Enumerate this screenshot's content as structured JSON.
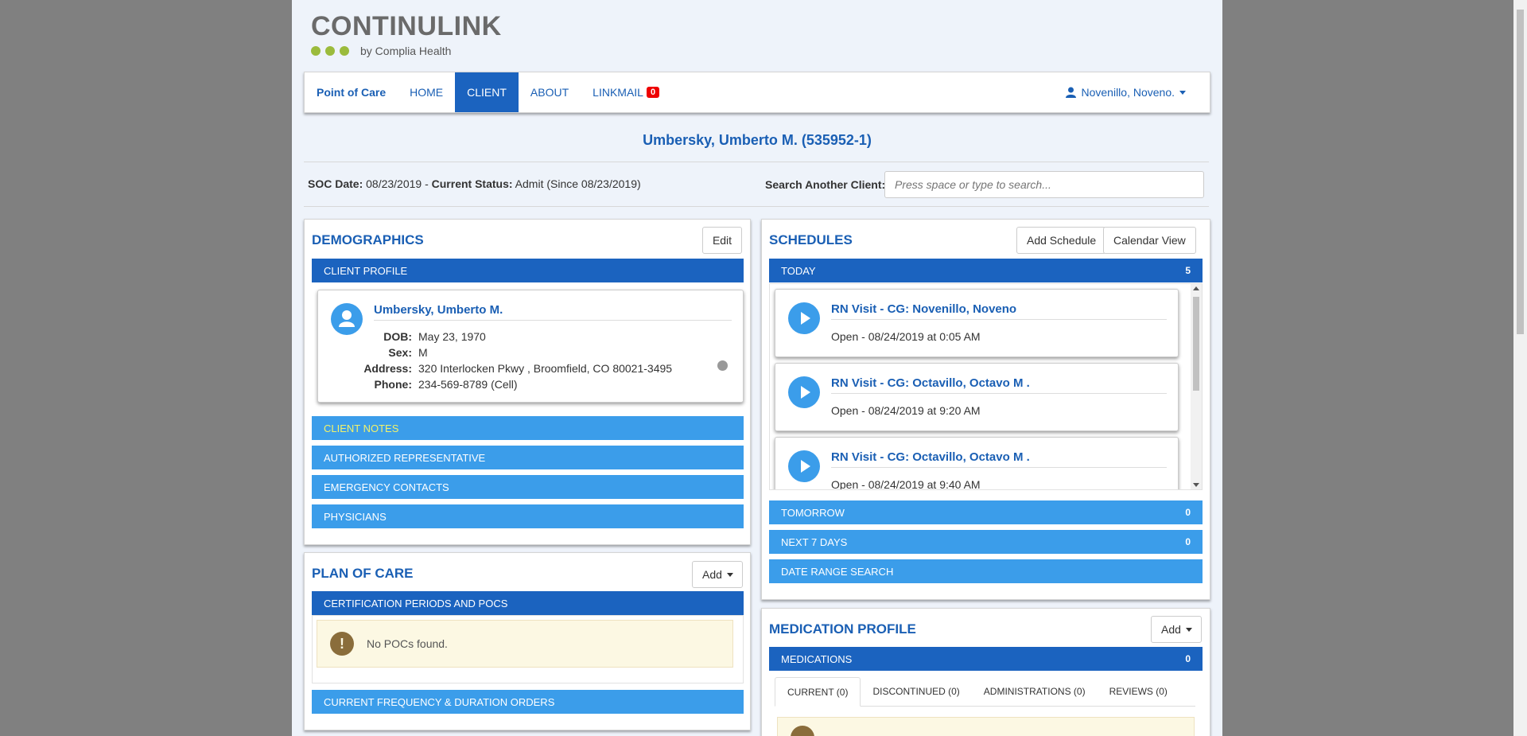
{
  "logo": {
    "word": "CONTINULINK",
    "by": "by Complia Health"
  },
  "nav": {
    "brand": "Point of Care",
    "items": [
      {
        "label": "HOME"
      },
      {
        "label": "CLIENT"
      },
      {
        "label": "ABOUT"
      },
      {
        "label": "LINKMAIL"
      }
    ],
    "linkmail_count": "0",
    "user": "Novenillo, Noveno."
  },
  "client": {
    "title": "Umbersky, Umberto M. (535952-1)",
    "soc_label": "SOC Date:",
    "soc_value": "08/23/2019 -",
    "status_label": "Current Status:",
    "status_value": "Admit (Since 08/23/2019)"
  },
  "search": {
    "label": "Search Another Client:",
    "placeholder": "Press space or type to search..."
  },
  "demographics": {
    "title": "DEMOGRAPHICS",
    "edit_label": "Edit",
    "profile_header": "CLIENT PROFILE",
    "name": "Umbersky, Umberto M.",
    "fields": [
      {
        "k": "DOB:",
        "v": "May 23, 1970"
      },
      {
        "k": "Sex:",
        "v": "M"
      },
      {
        "k": "Address:",
        "v": "320 Interlocken Pkwy , Broomfield, CO 80021-3495"
      },
      {
        "k": "Phone:",
        "v": "234-569-8789 (Cell)"
      }
    ],
    "sections": [
      "CLIENT NOTES",
      "AUTHORIZED REPRESENTATIVE",
      "EMERGENCY CONTACTS",
      "PHYSICIANS"
    ]
  },
  "plan_of_care": {
    "title": "PLAN OF CARE",
    "add_label": "Add",
    "cert_header": "CERTIFICATION PERIODS AND POCS",
    "empty_text": "No POCs found.",
    "freq_header": "CURRENT FREQUENCY & DURATION ORDERS"
  },
  "schedules": {
    "title": "SCHEDULES",
    "add_label": "Add Schedule",
    "calendar_label": "Calendar View",
    "today_label": "TODAY",
    "today_count": "5",
    "visits": [
      {
        "title": "RN Visit - CG: Novenillo, Noveno",
        "status": "Open - 08/24/2019 at 0:05 AM"
      },
      {
        "title": "RN Visit - CG: Octavillo, Octavo M .",
        "status": "Open - 08/24/2019 at 9:20 AM"
      },
      {
        "title": "RN Visit - CG: Octavillo, Octavo M .",
        "status": "Open - 08/24/2019 at 9:40 AM"
      }
    ],
    "tomorrow_label": "TOMORROW",
    "tomorrow_count": "0",
    "next7_label": "NEXT 7 DAYS",
    "next7_count": "0",
    "range_label": "DATE RANGE SEARCH"
  },
  "medication": {
    "title": "MEDICATION PROFILE",
    "add_label": "Add",
    "header": "MEDICATIONS",
    "count": "0",
    "tabs": [
      "CURRENT (0)",
      "DISCONTINUED (0)",
      "ADMINISTRATIONS (0)",
      "REVIEWS (0)"
    ]
  }
}
